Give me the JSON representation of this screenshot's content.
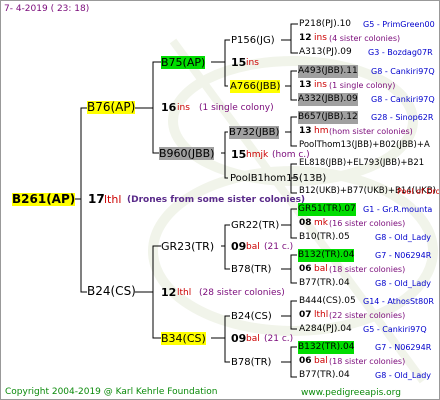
{
  "header": {
    "date": "7-  4-2019 ( 23: 18)"
  },
  "footer": {
    "copyright": "Copyright 2004-2019 @ Karl Kehrle Foundation",
    "url": "www.pedigreeapis.org"
  },
  "root": {
    "id": "B261(AP)",
    "num": "17",
    "race": "lthl",
    "note": "(Drones from some sister colonies)"
  },
  "gen1": [
    {
      "id": "B76(AP)",
      "num": "16",
      "race": "ins",
      "note": "(1 single colony)"
    },
    {
      "id": "B24(CS)",
      "num": "12",
      "race": "lthl",
      "note": "(28 sister colonies)"
    }
  ],
  "gen2": [
    {
      "id": "B75(AP)",
      "num": "15",
      "race": "ins",
      "note": ""
    },
    {
      "id": "B960(JBB)",
      "num": "15",
      "race": "hmjk",
      "note": "(hom c.)"
    },
    {
      "id": "GR23(TR)",
      "num": "09",
      "race": "bal",
      "note": "(21 c.)"
    },
    {
      "id": "B34(CS)",
      "num": "09",
      "race": "bal",
      "note": "(21 c.)"
    }
  ],
  "gen3": [
    {
      "id": "P156(JG)",
      "num": "",
      "race": ""
    },
    {
      "id": "A766(JBB)",
      "num": "",
      "race": ""
    },
    {
      "id": "B732(JBB)",
      "num": "",
      "race": ""
    },
    {
      "id": "PoolB1hom15(13B)",
      "num": "",
      "race": ""
    },
    {
      "id": "GR22(TR)",
      "num": "",
      "race": ""
    },
    {
      "id": "B78(TR)",
      "num": "",
      "race": ""
    },
    {
      "id": "B24(CS)",
      "num": "",
      "race": ""
    },
    {
      "id": "B78(TR)",
      "num": "",
      "race": ""
    }
  ],
  "gen4": [
    {
      "line1": "P218(PJ).10",
      "line1b": "G5 - PrimGreen00",
      "mid_num": "12",
      "mid_race": "ins",
      "mid_note": "(4 sister colonies)",
      "line3": "A313(PJ).09",
      "line3b": "G3 - Bozdag07R"
    },
    {
      "line1": "A493(JBB).11",
      "line1b": "G8 - Cankiri97Q",
      "mid_num": "13",
      "mid_race": "ins",
      "mid_note": "(1 single colony)",
      "line3": "A332(JBB).09",
      "line3b": "G8 - Cankiri97Q"
    },
    {
      "line1": "B657(JBB).12",
      "line1b": "G28 - Sinop62R",
      "mid_num": "13",
      "mid_race": "hm",
      "mid_note": "(hom sister colonies)",
      "line3": "PoolThom13(JBB)+B02(JBB)+A",
      "line3b": ""
    },
    {
      "line1": "EL818(JBB)+EL793(JBB)+B21",
      "line1b": "",
      "mid_num": "",
      "mid_race": "",
      "mid_note": "",
      "line3": "B12(UKB)+B77(UKB)+B14(UKB)",
      "line3b": "Pool of Drones"
    },
    {
      "line1": "GR51(TR).07",
      "line1b": "G1 - Gr.R.mounta",
      "mid_num": "08",
      "mid_race": "mk",
      "mid_note": "(16 sister colonies)",
      "line3": "B10(TR).05",
      "line3b": "G8 - Old_Lady"
    },
    {
      "line1": "B132(TR).04",
      "line1b": "G7 - N06294R",
      "mid_num": "06",
      "mid_race": "bal",
      "mid_note": "(18 sister colonies)",
      "line3": "B77(TR).04",
      "line3b": "G8 - Old_Lady"
    },
    {
      "line1": "B444(CS).05",
      "line1b": "G14 - AthosSt80R",
      "mid_num": "07",
      "mid_race": "lthl",
      "mid_note": "(22 sister colonies)",
      "line3": "A284(PJ).04",
      "line3b": "G5 - Cankiri97Q"
    },
    {
      "line1": "B132(TR).04",
      "line1b": "G7 - N06294R",
      "mid_num": "06",
      "mid_race": "bal",
      "mid_note": "(18 sister colonies)",
      "line3": "B77(TR).04",
      "line3b": "G8 - Old_Lady"
    }
  ]
}
